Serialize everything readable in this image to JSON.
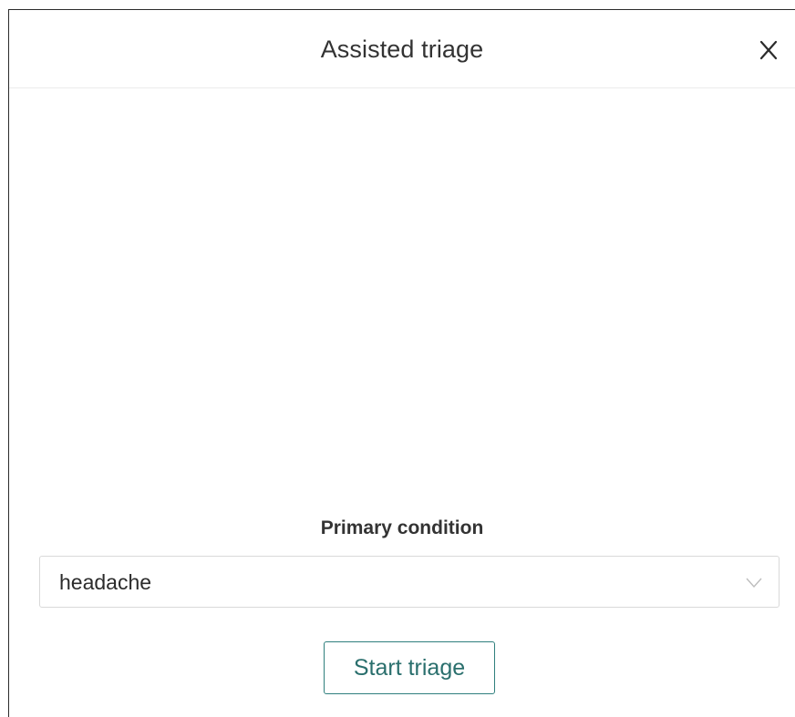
{
  "dialog": {
    "title": "Assisted triage",
    "close_icon": "close-icon"
  },
  "form": {
    "field_label": "Primary condition",
    "select_value": "headache",
    "chevron_icon": "chevron-down-icon",
    "start_button_label": "Start triage"
  },
  "colors": {
    "accent": "#2f7f7d",
    "text": "#333333",
    "border": "#d9d9d9"
  }
}
